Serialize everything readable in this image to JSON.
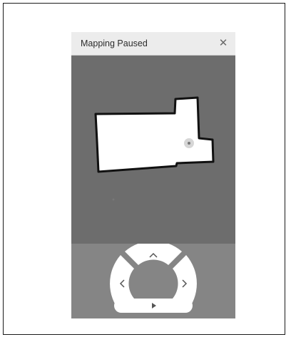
{
  "window": {
    "title": "Mapping Paused",
    "close_icon": "close-icon"
  },
  "map": {
    "icons": [
      "robot-position-icon",
      "dock-marker-icon"
    ]
  },
  "controls": {
    "dpad_icons": [
      "arrow-up-icon",
      "arrow-left-icon",
      "arrow-right-icon"
    ],
    "play_icon": "play-icon"
  },
  "colors": {
    "titlebar": "#ececec",
    "map_background": "#6d6d6d",
    "controls_background": "#858585",
    "control_fill": "#ffffff",
    "glyph": "#555555"
  }
}
